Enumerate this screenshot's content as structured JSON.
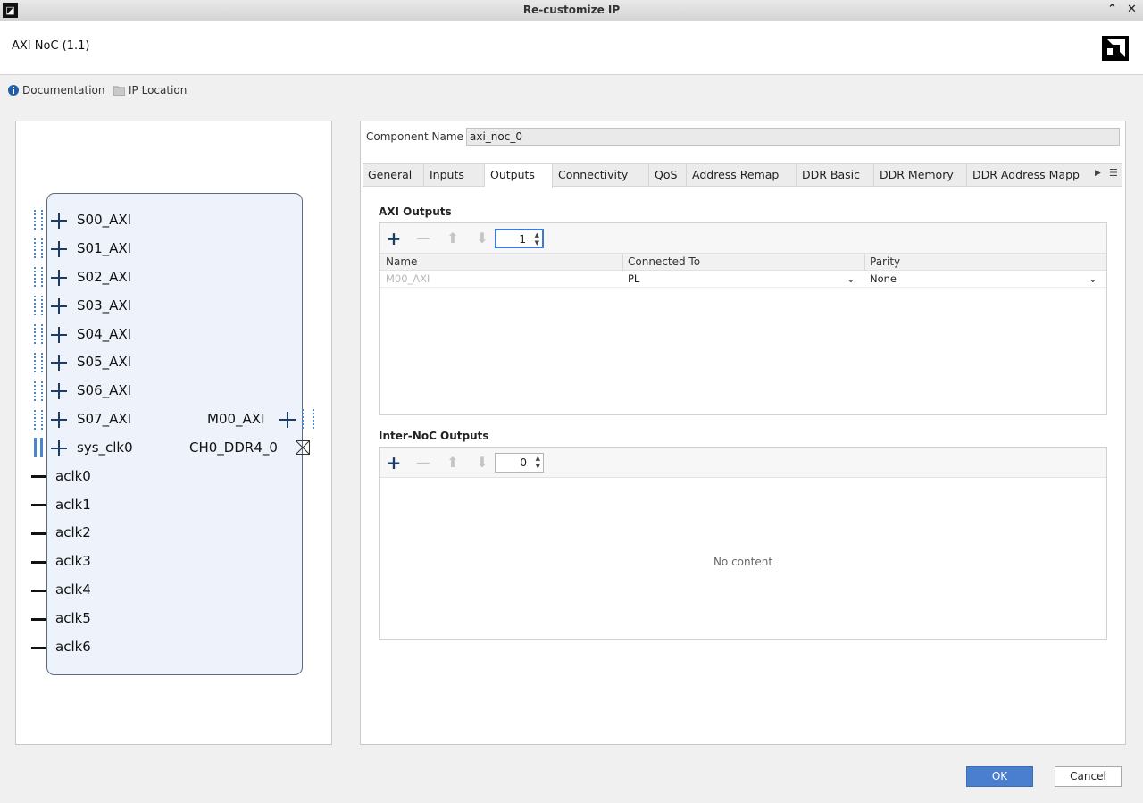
{
  "window": {
    "title": "Re-customize IP",
    "minimize_glyph": "⌃",
    "close_glyph": "✕"
  },
  "header": {
    "ip_title": "AXI NoC (1.1)"
  },
  "links": {
    "documentation": "Documentation",
    "ip_location": "IP Location"
  },
  "block": {
    "slave_ports": [
      "S00_AXI",
      "S01_AXI",
      "S02_AXI",
      "S03_AXI",
      "S04_AXI",
      "S05_AXI",
      "S06_AXI",
      "S07_AXI",
      "sys_clk0"
    ],
    "clock_ports": [
      "aclk0",
      "aclk1",
      "aclk2",
      "aclk3",
      "aclk4",
      "aclk5",
      "aclk6"
    ],
    "master_ports": [
      "M00_AXI",
      "CH0_DDR4_0"
    ]
  },
  "component": {
    "label": "Component Name",
    "value": "axi_noc_0"
  },
  "tabs": [
    {
      "label": "General"
    },
    {
      "label": "Inputs"
    },
    {
      "label": "Outputs",
      "active": true
    },
    {
      "label": "Connectivity"
    },
    {
      "label": "QoS"
    },
    {
      "label": "Address Remap"
    },
    {
      "label": "DDR Basic"
    },
    {
      "label": "DDR Memory"
    },
    {
      "label": "DDR Address Mapp"
    }
  ],
  "axi_outputs": {
    "title": "AXI Outputs",
    "count": "1",
    "columns": [
      "Name",
      "Connected To",
      "Parity"
    ],
    "rows": [
      {
        "name": "M00_AXI",
        "connected_to": "PL",
        "parity": "None"
      }
    ]
  },
  "internoc_outputs": {
    "title": "Inter-NoC Outputs",
    "count": "0",
    "empty_text": "No content"
  },
  "buttons": {
    "ok": "OK",
    "cancel": "Cancel"
  },
  "colors": {
    "accent": "#4a7fcf",
    "port_blue": "#1a3c66",
    "block_fill": "#eef3fb"
  }
}
